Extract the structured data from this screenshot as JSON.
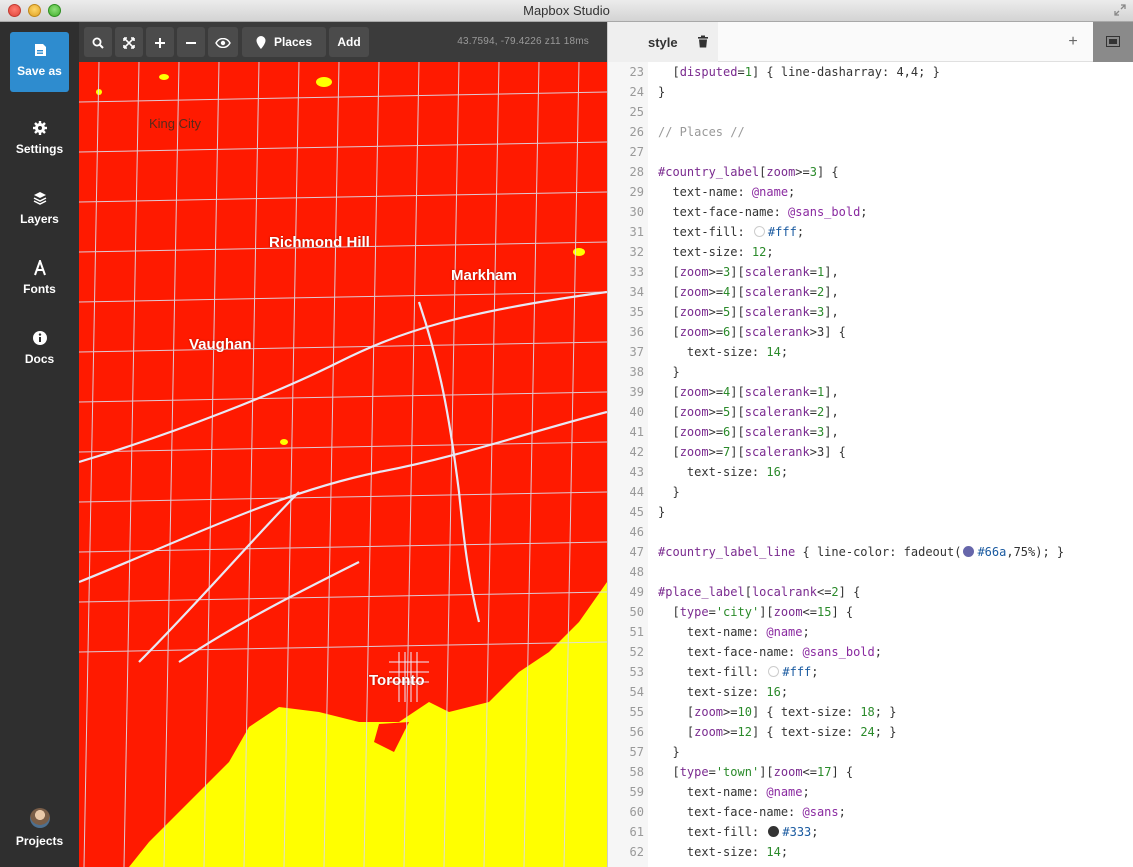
{
  "window": {
    "title": "Mapbox Studio"
  },
  "sidebar": {
    "save": {
      "label": "Save as",
      "icon": "save-icon"
    },
    "items": [
      {
        "label": "Settings",
        "icon": "gear-icon"
      },
      {
        "label": "Layers",
        "icon": "layers-icon"
      },
      {
        "label": "Fonts",
        "icon": "font-icon"
      },
      {
        "label": "Docs",
        "icon": "info-icon"
      }
    ],
    "projects": {
      "label": "Projects",
      "icon": "avatar"
    }
  },
  "toolbar": {
    "places_label": "Places",
    "add_label": "Add",
    "coords": "43.7594, -79.4226 z11 18ms"
  },
  "map": {
    "labels": {
      "king_city": "King City",
      "richmond_hill": "Richmond Hill",
      "markham": "Markham",
      "vaughan": "Vaughan",
      "toronto": "Toronto"
    },
    "colors": {
      "land": "#ff1a00",
      "water": "#ffff00",
      "roads": "#d8d8e8"
    }
  },
  "editor": {
    "tab": "style",
    "add_label": "+",
    "lines": [
      {
        "n": "23",
        "t": "  [disputed=1] { line-dasharray: 4,4; }"
      },
      {
        "n": "24",
        "t": "}"
      },
      {
        "n": "25",
        "t": ""
      },
      {
        "n": "26",
        "t": "// Places //"
      },
      {
        "n": "27",
        "t": ""
      },
      {
        "n": "28",
        "t": "#country_label[zoom>=3] {"
      },
      {
        "n": "29",
        "t": "  text-name: @name;"
      },
      {
        "n": "30",
        "t": "  text-face-name: @sans_bold;"
      },
      {
        "n": "31",
        "t": "  text-fill: #fff;"
      },
      {
        "n": "32",
        "t": "  text-size: 12;"
      },
      {
        "n": "33",
        "t": "  [zoom>=3][scalerank=1],"
      },
      {
        "n": "34",
        "t": "  [zoom>=4][scalerank=2],"
      },
      {
        "n": "35",
        "t": "  [zoom>=5][scalerank=3],"
      },
      {
        "n": "36",
        "t": "  [zoom>=6][scalerank>3] {"
      },
      {
        "n": "37",
        "t": "    text-size: 14;"
      },
      {
        "n": "38",
        "t": "  }"
      },
      {
        "n": "39",
        "t": "  [zoom>=4][scalerank=1],"
      },
      {
        "n": "40",
        "t": "  [zoom>=5][scalerank=2],"
      },
      {
        "n": "41",
        "t": "  [zoom>=6][scalerank=3],"
      },
      {
        "n": "42",
        "t": "  [zoom>=7][scalerank>3] {"
      },
      {
        "n": "43",
        "t": "    text-size: 16;"
      },
      {
        "n": "44",
        "t": "  }"
      },
      {
        "n": "45",
        "t": "}"
      },
      {
        "n": "46",
        "t": ""
      },
      {
        "n": "47",
        "t": "#country_label_line { line-color: fadeout(#66a,75%); }"
      },
      {
        "n": "48",
        "t": ""
      },
      {
        "n": "49",
        "t": "#place_label[localrank<=2] {"
      },
      {
        "n": "50",
        "t": "  [type='city'][zoom<=15] {"
      },
      {
        "n": "51",
        "t": "    text-name: @name;"
      },
      {
        "n": "52",
        "t": "    text-face-name: @sans_bold;"
      },
      {
        "n": "53",
        "t": "    text-fill: #fff;"
      },
      {
        "n": "54",
        "t": "    text-size: 16;"
      },
      {
        "n": "55",
        "t": "    [zoom>=10] { text-size: 18; }"
      },
      {
        "n": "56",
        "t": "    [zoom>=12] { text-size: 24; }"
      },
      {
        "n": "57",
        "t": "  }"
      },
      {
        "n": "58",
        "t": "  [type='town'][zoom<=17] {"
      },
      {
        "n": "59",
        "t": "    text-name: @name;"
      },
      {
        "n": "60",
        "t": "    text-face-name: @sans;"
      },
      {
        "n": "61",
        "t": "    text-fill: #333;"
      },
      {
        "n": "62",
        "t": "    text-size: 14;"
      }
    ]
  }
}
